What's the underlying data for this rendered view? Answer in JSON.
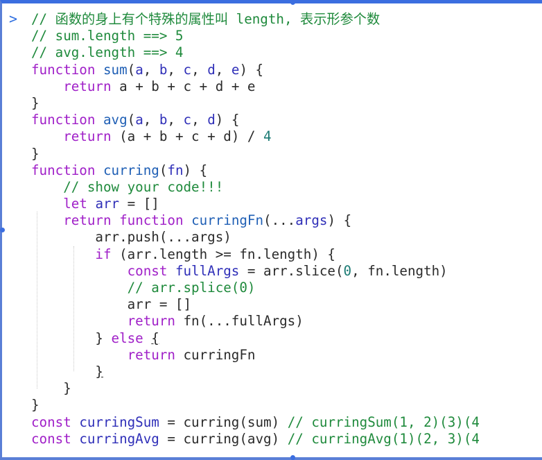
{
  "console": {
    "prompt_symbol": ">",
    "lines": [
      [
        {
          "t": "// 函数的身上有个特殊的属性叫 length, 表示形参个数",
          "c": "c"
        }
      ],
      [
        {
          "t": "// sum.length ==> 5",
          "c": "c"
        }
      ],
      [
        {
          "t": "// avg.length ==> 4",
          "c": "c"
        }
      ],
      [
        {
          "t": "function ",
          "c": "k"
        },
        {
          "t": "sum",
          "c": "f"
        },
        {
          "t": "(",
          "c": "t"
        },
        {
          "t": "a",
          "c": "p"
        },
        {
          "t": ", ",
          "c": "t"
        },
        {
          "t": "b",
          "c": "p"
        },
        {
          "t": ", ",
          "c": "t"
        },
        {
          "t": "c",
          "c": "p"
        },
        {
          "t": ", ",
          "c": "t"
        },
        {
          "t": "d",
          "c": "p"
        },
        {
          "t": ", ",
          "c": "t"
        },
        {
          "t": "e",
          "c": "p"
        },
        {
          "t": ") {",
          "c": "t"
        }
      ],
      [
        {
          "t": "    ",
          "c": "t"
        },
        {
          "t": "return ",
          "c": "k"
        },
        {
          "t": "a + b + c + d + e",
          "c": "t"
        }
      ],
      [
        {
          "t": "}",
          "c": "t"
        }
      ],
      [
        {
          "t": "function ",
          "c": "k"
        },
        {
          "t": "avg",
          "c": "f"
        },
        {
          "t": "(",
          "c": "t"
        },
        {
          "t": "a",
          "c": "p"
        },
        {
          "t": ", ",
          "c": "t"
        },
        {
          "t": "b",
          "c": "p"
        },
        {
          "t": ", ",
          "c": "t"
        },
        {
          "t": "c",
          "c": "p"
        },
        {
          "t": ", ",
          "c": "t"
        },
        {
          "t": "d",
          "c": "p"
        },
        {
          "t": ") {",
          "c": "t"
        }
      ],
      [
        {
          "t": "    ",
          "c": "t"
        },
        {
          "t": "return ",
          "c": "k"
        },
        {
          "t": "(a + b + c + d) / ",
          "c": "t"
        },
        {
          "t": "4",
          "c": "n"
        }
      ],
      [
        {
          "t": "}",
          "c": "t"
        }
      ],
      [
        {
          "t": "function ",
          "c": "k"
        },
        {
          "t": "curring",
          "c": "f"
        },
        {
          "t": "(",
          "c": "t"
        },
        {
          "t": "fn",
          "c": "p"
        },
        {
          "t": ") {",
          "c": "t"
        }
      ],
      [
        {
          "t": "    ",
          "c": "t"
        },
        {
          "t": "// show your code!!!",
          "c": "c"
        }
      ],
      [
        {
          "t": "    ",
          "c": "t"
        },
        {
          "t": "let ",
          "c": "k"
        },
        {
          "t": "arr",
          "c": "p"
        },
        {
          "t": " = []",
          "c": "t"
        }
      ],
      [
        {
          "t": "    ",
          "c": "t"
        },
        {
          "t": "return ",
          "c": "k"
        },
        {
          "t": "function ",
          "c": "k"
        },
        {
          "t": "curringFn",
          "c": "f"
        },
        {
          "t": "(...",
          "c": "t"
        },
        {
          "t": "args",
          "c": "p"
        },
        {
          "t": ") {",
          "c": "t"
        }
      ],
      [
        {
          "t": "        arr.push(...args)",
          "c": "t"
        }
      ],
      [
        {
          "t": "        ",
          "c": "t"
        },
        {
          "t": "if ",
          "c": "k"
        },
        {
          "t": "(arr.length >= fn.length) {",
          "c": "t"
        }
      ],
      [
        {
          "t": "            ",
          "c": "t"
        },
        {
          "t": "const ",
          "c": "k"
        },
        {
          "t": "fullArgs",
          "c": "p"
        },
        {
          "t": " = arr.slice(",
          "c": "t"
        },
        {
          "t": "0",
          "c": "n"
        },
        {
          "t": ", fn.length)",
          "c": "t"
        }
      ],
      [
        {
          "t": "            ",
          "c": "t"
        },
        {
          "t": "// arr.splice(0)",
          "c": "c"
        }
      ],
      [
        {
          "t": "            arr = []",
          "c": "t"
        }
      ],
      [
        {
          "t": "            ",
          "c": "t"
        },
        {
          "t": "return ",
          "c": "k"
        },
        {
          "t": "fn(...fullArgs)",
          "c": "t"
        }
      ],
      [
        {
          "t": "        } ",
          "c": "t"
        },
        {
          "t": "else ",
          "c": "k"
        },
        {
          "t": "{",
          "c": "tu"
        }
      ],
      [
        {
          "t": "            ",
          "c": "t"
        },
        {
          "t": "return ",
          "c": "k"
        },
        {
          "t": "curringFn",
          "c": "t"
        }
      ],
      [
        {
          "t": "        ",
          "c": "t"
        },
        {
          "t": "}",
          "c": "tu"
        }
      ],
      [
        {
          "t": "    }",
          "c": "t"
        }
      ],
      [
        {
          "t": "}",
          "c": "t"
        }
      ],
      [
        {
          "t": "const ",
          "c": "k"
        },
        {
          "t": "curringSum",
          "c": "p"
        },
        {
          "t": " = curring(sum) ",
          "c": "t"
        },
        {
          "t": "// curringSum(1, 2)(3)(4",
          "c": "c"
        }
      ],
      [
        {
          "t": "const ",
          "c": "k"
        },
        {
          "t": "curringAvg",
          "c": "p"
        },
        {
          "t": " = curring(avg) ",
          "c": "t"
        },
        {
          "t": "// curringAvg(1)(2, 3)(4",
          "c": "c"
        }
      ]
    ]
  },
  "colors": {
    "comment": "#1f8a3c",
    "keyword": "#a020c8",
    "function_name": "#1f5fb5",
    "variable": "#2f2fb8",
    "number": "#1a7a73",
    "selection_border": "#3b6ee0"
  }
}
